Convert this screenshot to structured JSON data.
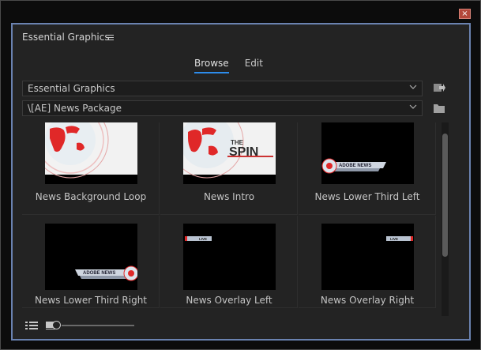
{
  "window": {
    "close_glyph": "×"
  },
  "panel": {
    "title": "Essential Graphics"
  },
  "tabs": [
    {
      "label": "Browse",
      "active": true
    },
    {
      "label": "Edit",
      "active": false
    }
  ],
  "dropdowns": {
    "source": {
      "value": "Essential Graphics"
    },
    "folder": {
      "value": "\\[AE] News Package"
    }
  },
  "templates": [
    {
      "name": "News Background Loop",
      "thumb": "globe"
    },
    {
      "name": "News Intro",
      "thumb": "spin"
    },
    {
      "name": "News Lower Third Left",
      "thumb": "lower-left"
    },
    {
      "name": "News Lower Third Right",
      "thumb": "lower-right"
    },
    {
      "name": "News Overlay Left",
      "thumb": "overlay-left"
    },
    {
      "name": "News Overlay Right",
      "thumb": "overlay-right"
    }
  ],
  "thumb_text": {
    "spin_the": "THE",
    "spin_word": "SPIN",
    "adobe_news": "ADOBE NEWS",
    "live": "LIVE"
  },
  "icons": [
    "menu-icon",
    "import-icon",
    "folder-icon",
    "list-view-icon",
    "thumbnail-view-icon",
    "chevron-down-icon",
    "close-icon"
  ],
  "colors": {
    "accent": "#2d8ceb",
    "panel_border": "#6a82b0",
    "close": "#b4473a",
    "map_red": "#e02828"
  },
  "zoom": {
    "level": 0.0
  }
}
